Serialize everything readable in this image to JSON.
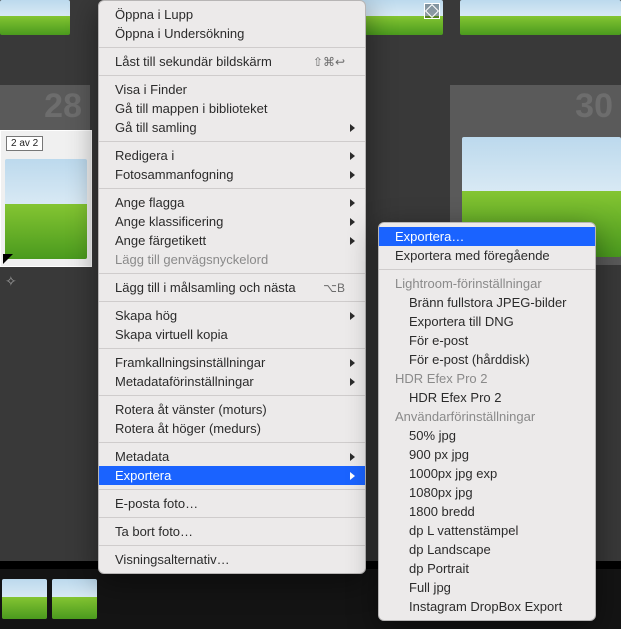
{
  "grid": {
    "cell_numbers": [
      "28",
      "30"
    ],
    "sel_badge": "2 av 2"
  },
  "menu1": {
    "open_loupe": "Öppna i Lupp",
    "open_survey": "Öppna i Undersökning",
    "lock_secondary": "Låst till sekundär bildskärm",
    "lock_secondary_sc": "⇧⌘↩",
    "show_in_finder": "Visa i Finder",
    "go_lib_folder": "Gå till mappen i biblioteket",
    "go_collection": "Gå till samling",
    "edit_in": "Redigera i",
    "photo_merge": "Fotosammanfogning",
    "set_flag": "Ange flagga",
    "set_rating": "Ange klassificering",
    "set_color": "Ange färgetikett",
    "add_keywords": "Lägg till genvägsnyckelord",
    "add_target_next": "Lägg till i målsamling och nästa",
    "add_target_next_sc": "⌥B",
    "stack": "Skapa hög",
    "virtual_copy": "Skapa virtuell kopia",
    "develop_settings": "Framkallningsinställningar",
    "metadata_presets": "Metadataförinställningar",
    "rotate_ccw": "Rotera åt vänster (moturs)",
    "rotate_cw": "Rotera åt höger (medurs)",
    "metadata": "Metadata",
    "export": "Exportera",
    "email": "E-posta foto…",
    "delete": "Ta bort foto…",
    "view_options": "Visningsalternativ…"
  },
  "menu2": {
    "export_dlg": "Exportera…",
    "export_prev": "Exportera med föregående",
    "hdr_lr": "Lightroom-förinställningar",
    "lr_burn": "Bränn fullstora JPEG-bilder",
    "lr_dng": "Exportera till DNG",
    "lr_email": "För e-post",
    "lr_email_hd": "För e-post (hårddisk)",
    "hdr_efex": "HDR Efex Pro 2",
    "efex": "HDR Efex Pro 2",
    "hdr_user": "Användarförinställningar",
    "u_50": "50% jpg",
    "u_900": "900 px jpg",
    "u_1000": "1000px jpg exp",
    "u_1080": "1080px jpg",
    "u_1800": "1800 bredd",
    "u_dpl": "dp L vattenstämpel",
    "u_land": "dp Landscape",
    "u_port": "dp Portrait",
    "u_full": "Full jpg",
    "u_ig": "Instagram DropBox Export"
  }
}
